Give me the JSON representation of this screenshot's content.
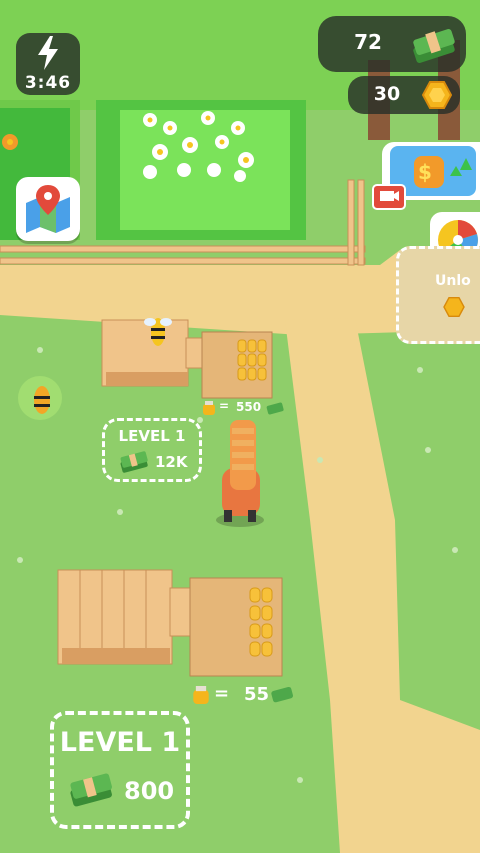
{
  "hud": {
    "timer": "3:46",
    "cash": "72",
    "coins": "30"
  },
  "side_buttons": {
    "unlock_label": "Unlo"
  },
  "plots": [
    {
      "level_label": "LEVEL 1",
      "price": "12K",
      "rate_value": "550"
    },
    {
      "level_label": "LEVEL 1",
      "price": "800",
      "rate_value": "55"
    }
  ],
  "rate_separator": "=",
  "colors": {
    "grass": "#8fce6a",
    "path": "#f2d48f",
    "hud_dark": "#283028",
    "cash_green": "#4ea84a",
    "coin_gold": "#f5b51c",
    "wood": "#f0c48a",
    "video_red": "#e24a3b"
  }
}
